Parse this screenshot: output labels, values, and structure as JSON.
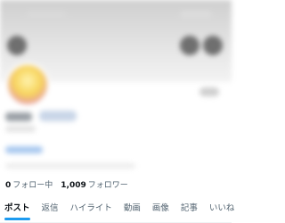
{
  "follow_stats": {
    "following_count": "0",
    "following_label": "フォロー中",
    "followers_count": "1,009",
    "followers_label": "フォロワー"
  },
  "tabs": [
    {
      "label": "ポスト",
      "active": true
    },
    {
      "label": "返信"
    },
    {
      "label": "ハイライト"
    },
    {
      "label": "動画"
    },
    {
      "label": "画像"
    },
    {
      "label": "記事"
    },
    {
      "label": "いいね"
    }
  ],
  "colors": {
    "accent": "#1d9bf0",
    "text_primary": "#0f1419",
    "text_secondary": "#536471"
  },
  "icons": [
    "back-icon",
    "search-icon",
    "more-icon"
  ]
}
